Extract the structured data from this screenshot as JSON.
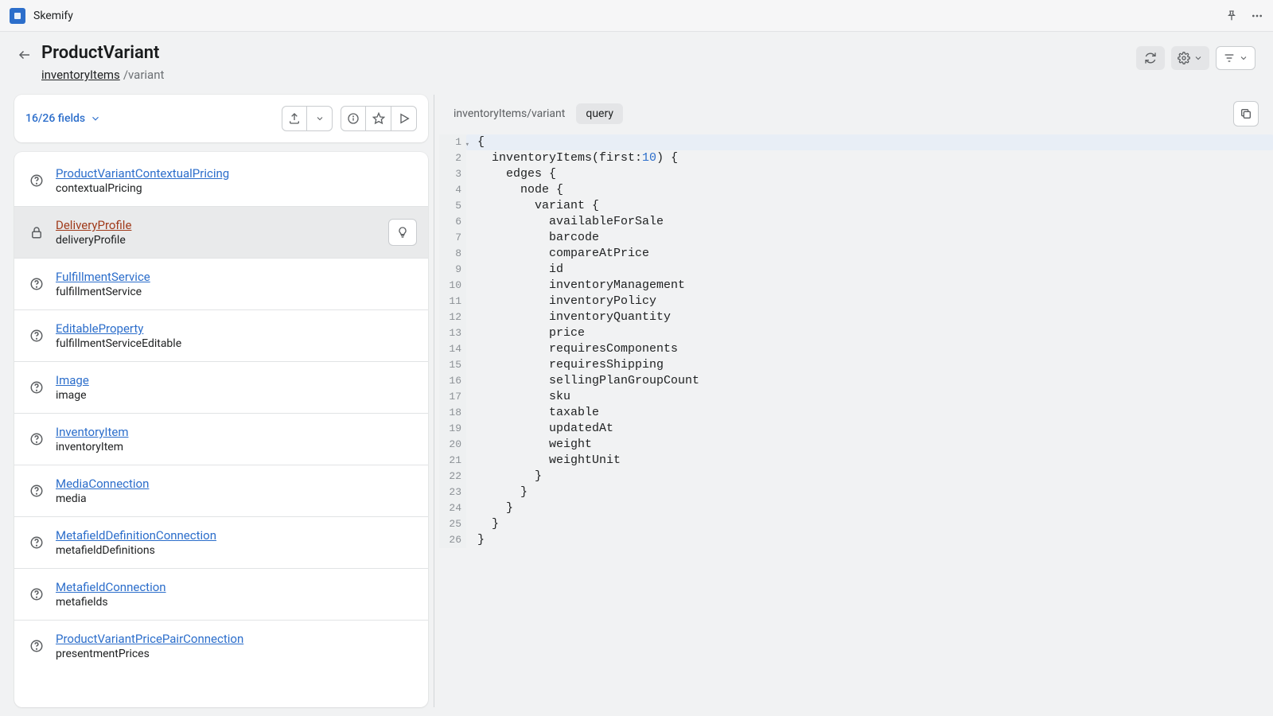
{
  "app": {
    "name": "Skemify"
  },
  "header": {
    "title": "ProductVariant",
    "breadcrumb_link": "inventoryItems",
    "breadcrumb_tail": "/variant"
  },
  "panel": {
    "fields_label": "16/26 fields"
  },
  "fields": [
    {
      "type": "ProductVariantContextualPricing",
      "name": "contextualPricing",
      "icon": "help",
      "selected": false
    },
    {
      "type": "DeliveryProfile",
      "name": "deliveryProfile",
      "icon": "lock",
      "selected": true
    },
    {
      "type": "FulfillmentService",
      "name": "fulfillmentService",
      "icon": "help",
      "selected": false
    },
    {
      "type": "EditableProperty",
      "name": "fulfillmentServiceEditable",
      "icon": "help",
      "selected": false
    },
    {
      "type": "Image",
      "name": "image",
      "icon": "help",
      "selected": false
    },
    {
      "type": "InventoryItem",
      "name": "inventoryItem",
      "icon": "help",
      "selected": false
    },
    {
      "type": "MediaConnection",
      "name": "media",
      "icon": "help",
      "selected": false
    },
    {
      "type": "MetafieldDefinitionConnection",
      "name": "metafieldDefinitions",
      "icon": "help",
      "selected": false
    },
    {
      "type": "MetafieldConnection",
      "name": "metafields",
      "icon": "help",
      "selected": false
    },
    {
      "type": "ProductVariantPricePairConnection",
      "name": "presentmentPrices",
      "icon": "help",
      "selected": false
    }
  ],
  "code": {
    "path_label": "inventoryItems/variant",
    "active_tab": "query",
    "lines": [
      {
        "n": 1,
        "t": "{",
        "hl": true,
        "fold": true
      },
      {
        "n": 2,
        "t": "  inventoryItems(first:",
        "num": "10",
        "tail": ") {"
      },
      {
        "n": 3,
        "t": "    edges {"
      },
      {
        "n": 4,
        "t": "      node {"
      },
      {
        "n": 5,
        "t": "        variant {"
      },
      {
        "n": 6,
        "t": "          availableForSale"
      },
      {
        "n": 7,
        "t": "          barcode"
      },
      {
        "n": 8,
        "t": "          compareAtPrice"
      },
      {
        "n": 9,
        "t": "          id"
      },
      {
        "n": 10,
        "t": "          inventoryManagement"
      },
      {
        "n": 11,
        "t": "          inventoryPolicy"
      },
      {
        "n": 12,
        "t": "          inventoryQuantity"
      },
      {
        "n": 13,
        "t": "          price"
      },
      {
        "n": 14,
        "t": "          requiresComponents"
      },
      {
        "n": 15,
        "t": "          requiresShipping"
      },
      {
        "n": 16,
        "t": "          sellingPlanGroupCount"
      },
      {
        "n": 17,
        "t": "          sku"
      },
      {
        "n": 18,
        "t": "          taxable"
      },
      {
        "n": 19,
        "t": "          updatedAt"
      },
      {
        "n": 20,
        "t": "          weight"
      },
      {
        "n": 21,
        "t": "          weightUnit"
      },
      {
        "n": 22,
        "t": "        }"
      },
      {
        "n": 23,
        "t": "      }"
      },
      {
        "n": 24,
        "t": "    }"
      },
      {
        "n": 25,
        "t": "  }"
      },
      {
        "n": 26,
        "t": "}"
      }
    ]
  }
}
